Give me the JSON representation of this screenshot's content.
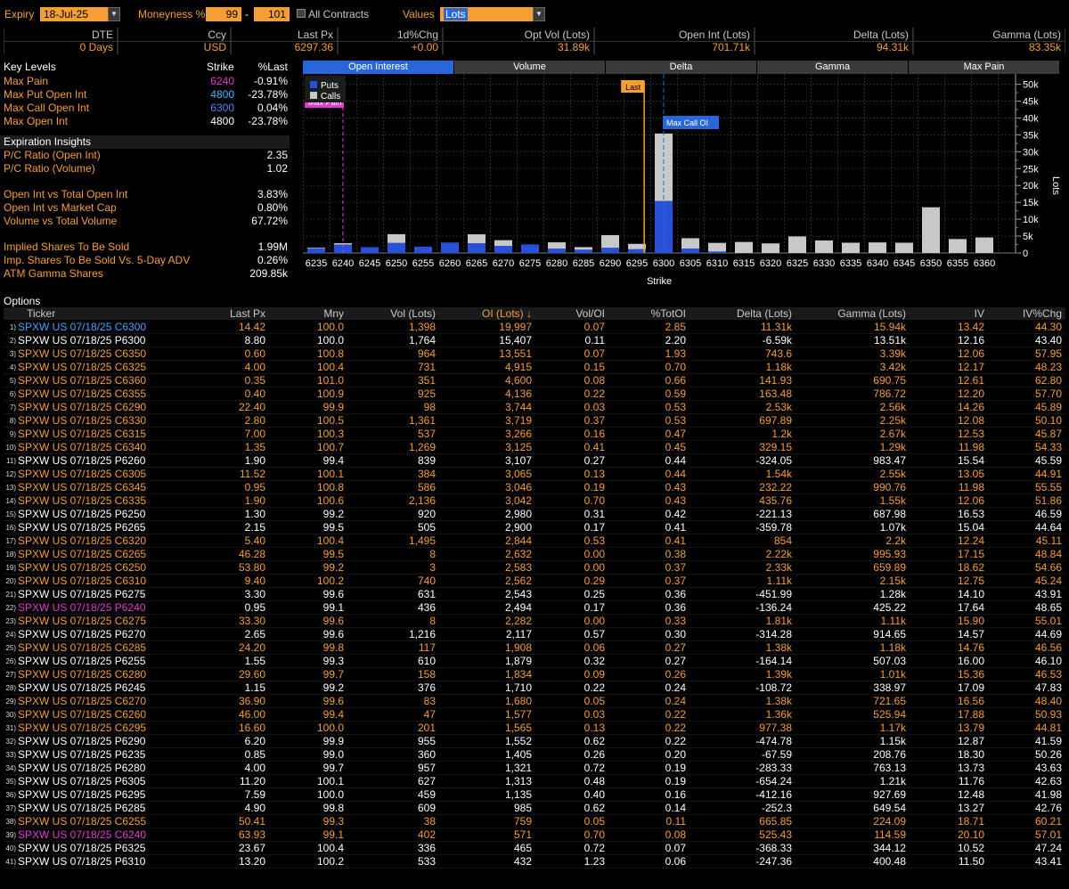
{
  "toolbar": {
    "expiry_label": "Expiry",
    "expiry_value": "18-Jul-25",
    "moneyness_label": "Moneyness %",
    "moneyness_low": "99",
    "moneyness_sep": "-",
    "moneyness_high": "101",
    "all_contracts_label": "All Contracts",
    "values_label": "Values",
    "values_value": "Lots"
  },
  "summary": {
    "headers": [
      "DTE",
      "Ccy",
      "Last Px",
      "1d%Chg",
      "Opt Vol (Lots)",
      "Open Int (Lots)",
      "Delta (Lots)",
      "Gamma (Lots)"
    ],
    "values": [
      "0 Days",
      "USD",
      "6297.36",
      "+0.00",
      "31.89k",
      "701.71k",
      "94.31k",
      "83.35k"
    ]
  },
  "key_levels": {
    "title": "Key Levels",
    "col_strike": "Strike",
    "col_pct": "%Last",
    "rows": [
      {
        "label": "Max Pain",
        "strike": "6240",
        "pct": "-0.91%",
        "color": "#e23bd3"
      },
      {
        "label": "Max Put Open Int",
        "strike": "4800",
        "pct": "-23.78%",
        "color": "#46b4ff"
      },
      {
        "label": "Max Call Open Int",
        "strike": "6300",
        "pct": "0.04%",
        "color": "#5b7fff"
      },
      {
        "label": "Max Open Int",
        "strike": "4800",
        "pct": "-23.78%",
        "color": "#ffffff"
      }
    ]
  },
  "insights": {
    "title": "Expiration Insights",
    "rows": [
      {
        "label": "P/C Ratio (Open Int)",
        "value": "2.35"
      },
      {
        "label": "P/C Ratio (Volume)",
        "value": "1.02"
      },
      {
        "label": "Open Int vs Total Open Int",
        "value": "3.83%"
      },
      {
        "label": "Open Int vs Market Cap",
        "value": "0.80%"
      },
      {
        "label": "Volume vs Total Volume",
        "value": "67.72%"
      },
      {
        "label": "Implied Shares To Be Sold",
        "value": "1.99M"
      },
      {
        "label": "Imp. Shares To Be Sold Vs. 5-Day ADV",
        "value": "0.26%"
      },
      {
        "label": "ATM Gamma Shares",
        "value": "209.85k"
      }
    ]
  },
  "chart_tabs": [
    "Open Interest",
    "Volume",
    "Delta",
    "Gamma",
    "Max Pain"
  ],
  "chart_data": {
    "type": "bar",
    "stacked": true,
    "xlabel": "Strike",
    "ylabel": "Lots",
    "ylim": [
      0,
      52000
    ],
    "yticks": [
      "0",
      "5k",
      "10k",
      "15k",
      "20k",
      "25k",
      "30k",
      "35k",
      "40k",
      "45k",
      "50k"
    ],
    "categories": [
      "6235",
      "6240",
      "6245",
      "6250",
      "6255",
      "6260",
      "6265",
      "6270",
      "6275",
      "6280",
      "6285",
      "6290",
      "6295",
      "6300",
      "6305",
      "6310",
      "6315",
      "6320",
      "6325",
      "6330",
      "6335",
      "6340",
      "6345",
      "6350",
      "6355",
      "6360"
    ],
    "series": [
      {
        "name": "Puts",
        "color": "#2850d8",
        "values": [
          1405,
          2494,
          1710,
          2980,
          1879,
          3107,
          2900,
          2117,
          2543,
          1321,
          985,
          1552,
          1135,
          15407,
          1313,
          432,
          0,
          0,
          0,
          0,
          0,
          0,
          0,
          0,
          0,
          0
        ]
      },
      {
        "name": "Calls",
        "color": "#c8c8c8",
        "values": [
          200,
          400,
          0,
          2583,
          0,
          0,
          2632,
          1680,
          0,
          1834,
          759,
          3744,
          1565,
          19997,
          3065,
          2562,
          3266,
          2844,
          4915,
          3719,
          3042,
          3125,
          3046,
          13551,
          4136,
          4600
        ]
      }
    ],
    "legend_position": "top-left",
    "annotations": [
      {
        "text": "Max Pain",
        "strike": "6240",
        "color": "#e23bd3"
      },
      {
        "text": "Last",
        "strike": "6297.36",
        "color": "#f59e35"
      },
      {
        "text": "Max Call OI",
        "strike": "6300",
        "color": "#2966d8"
      }
    ]
  },
  "options": {
    "title": "Options",
    "headers": [
      "Ticker",
      "Last Px",
      "Mny",
      "Vol (Lots)",
      "OI (Lots) ↓",
      "Vol/OI",
      "%TotOI",
      "Delta (Lots)",
      "Gamma (Lots)",
      "IV",
      "IV%Chg"
    ],
    "rows": [
      {
        "i": "1)",
        "t": "SPXW US 07/18/25 C6300",
        "c": "#46a0ff",
        "v": [
          "14.42",
          "100.0",
          "1,398",
          "19,997",
          "0.07",
          "2.85",
          "11.31k",
          "15.94k",
          "13.42",
          "44.30"
        ]
      },
      {
        "i": "2)",
        "t": "SPXW US 07/18/25 P6300",
        "c": "#ffffff",
        "v": [
          "8.80",
          "100.0",
          "1,764",
          "15,407",
          "0.11",
          "2.20",
          "-6.59k",
          "13.51k",
          "12.16",
          "43.40"
        ]
      },
      {
        "i": "3)",
        "t": "SPXW US 07/18/25 C6350",
        "c": "#f59e35",
        "v": [
          "0.60",
          "100.8",
          "964",
          "13,551",
          "0.07",
          "1.93",
          "743.6",
          "3.39k",
          "12.06",
          "57.95"
        ]
      },
      {
        "i": "4)",
        "t": "SPXW US 07/18/25 C6325",
        "c": "#f59e35",
        "v": [
          "4.00",
          "100.4",
          "731",
          "4,915",
          "0.15",
          "0.70",
          "1.18k",
          "3.42k",
          "12.17",
          "48.23"
        ]
      },
      {
        "i": "5)",
        "t": "SPXW US 07/18/25 C6360",
        "c": "#f59e35",
        "v": [
          "0.35",
          "101.0",
          "351",
          "4,600",
          "0.08",
          "0.66",
          "141.93",
          "690.75",
          "12.61",
          "62.80"
        ]
      },
      {
        "i": "6)",
        "t": "SPXW US 07/18/25 C6355",
        "c": "#f59e35",
        "v": [
          "0.40",
          "100.9",
          "925",
          "4,136",
          "0.22",
          "0.59",
          "163.48",
          "786.72",
          "12.20",
          "57.70"
        ]
      },
      {
        "i": "7)",
        "t": "SPXW US 07/18/25 C6290",
        "c": "#f59e35",
        "v": [
          "22.40",
          "99.9",
          "98",
          "3,744",
          "0.03",
          "0.53",
          "2.53k",
          "2.56k",
          "14.26",
          "45.89"
        ]
      },
      {
        "i": "8)",
        "t": "SPXW US 07/18/25 C6330",
        "c": "#f59e35",
        "v": [
          "2.80",
          "100.5",
          "1,361",
          "3,719",
          "0.37",
          "0.53",
          "697.89",
          "2.25k",
          "12.08",
          "50.10"
        ]
      },
      {
        "i": "9)",
        "t": "SPXW US 07/18/25 C6315",
        "c": "#f59e35",
        "v": [
          "7.00",
          "100.3",
          "537",
          "3,266",
          "0.16",
          "0.47",
          "1.2k",
          "2.67k",
          "12.53",
          "45.87"
        ]
      },
      {
        "i": "10)",
        "t": "SPXW US 07/18/25 C6340",
        "c": "#f59e35",
        "v": [
          "1.35",
          "100.7",
          "1,269",
          "3,125",
          "0.41",
          "0.45",
          "329.15",
          "1.29k",
          "11.98",
          "54.33"
        ]
      },
      {
        "i": "11)",
        "t": "SPXW US 07/18/25 P6260",
        "c": "#ffffff",
        "v": [
          "1.90",
          "99.4",
          "839",
          "3,107",
          "0.27",
          "0.44",
          "-324.05",
          "983.47",
          "15.54",
          "45.59"
        ]
      },
      {
        "i": "12)",
        "t": "SPXW US 07/18/25 C6305",
        "c": "#f59e35",
        "v": [
          "11.52",
          "100.1",
          "384",
          "3,065",
          "0.13",
          "0.44",
          "1.54k",
          "2.55k",
          "13.05",
          "44.91"
        ]
      },
      {
        "i": "13)",
        "t": "SPXW US 07/18/25 C6345",
        "c": "#f59e35",
        "v": [
          "0.95",
          "100.8",
          "586",
          "3,046",
          "0.19",
          "0.43",
          "232.22",
          "990.76",
          "11.98",
          "55.55"
        ]
      },
      {
        "i": "14)",
        "t": "SPXW US 07/18/25 C6335",
        "c": "#f59e35",
        "v": [
          "1.90",
          "100.6",
          "2,136",
          "3,042",
          "0.70",
          "0.43",
          "435.76",
          "1.55k",
          "12.06",
          "51.86"
        ]
      },
      {
        "i": "15)",
        "t": "SPXW US 07/18/25 P6250",
        "c": "#ffffff",
        "v": [
          "1.30",
          "99.2",
          "920",
          "2,980",
          "0.31",
          "0.42",
          "-221.13",
          "687.98",
          "16.53",
          "46.59"
        ]
      },
      {
        "i": "16)",
        "t": "SPXW US 07/18/25 P6265",
        "c": "#ffffff",
        "v": [
          "2.15",
          "99.5",
          "505",
          "2,900",
          "0.17",
          "0.41",
          "-359.78",
          "1.07k",
          "15.04",
          "44.64"
        ]
      },
      {
        "i": "17)",
        "t": "SPXW US 07/18/25 C6320",
        "c": "#f59e35",
        "v": [
          "5.40",
          "100.4",
          "1,495",
          "2,844",
          "0.53",
          "0.41",
          "854",
          "2.2k",
          "12.24",
          "45.11"
        ]
      },
      {
        "i": "18)",
        "t": "SPXW US 07/18/25 C6265",
        "c": "#f59e35",
        "v": [
          "46.28",
          "99.5",
          "8",
          "2,632",
          "0.00",
          "0.38",
          "2.22k",
          "995.93",
          "17.15",
          "48.84"
        ]
      },
      {
        "i": "19)",
        "t": "SPXW US 07/18/25 C6250",
        "c": "#f59e35",
        "v": [
          "53.80",
          "99.2",
          "3",
          "2,583",
          "0.00",
          "0.37",
          "2.33k",
          "659.89",
          "18.62",
          "54.66"
        ]
      },
      {
        "i": "20)",
        "t": "SPXW US 07/18/25 C6310",
        "c": "#f59e35",
        "v": [
          "9.40",
          "100.2",
          "740",
          "2,562",
          "0.29",
          "0.37",
          "1.11k",
          "2.15k",
          "12.75",
          "45.24"
        ]
      },
      {
        "i": "21)",
        "t": "SPXW US 07/18/25 P6275",
        "c": "#ffffff",
        "v": [
          "3.30",
          "99.6",
          "631",
          "2,543",
          "0.25",
          "0.36",
          "-451.99",
          "1.28k",
          "14.10",
          "43.91"
        ]
      },
      {
        "i": "22)",
        "t": "SPXW US 07/18/25 P6240",
        "c": "#e23bd3",
        "v": [
          "0.95",
          "99.1",
          "436",
          "2,494",
          "0.17",
          "0.36",
          "-136.24",
          "425.22",
          "17.64",
          "48.65"
        ]
      },
      {
        "i": "23)",
        "t": "SPXW US 07/18/25 C6275",
        "c": "#f59e35",
        "v": [
          "33.30",
          "99.6",
          "8",
          "2,282",
          "0.00",
          "0.33",
          "1.81k",
          "1.11k",
          "15.90",
          "55.01"
        ]
      },
      {
        "i": "24)",
        "t": "SPXW US 07/18/25 P6270",
        "c": "#ffffff",
        "v": [
          "2.65",
          "99.6",
          "1,216",
          "2,117",
          "0.57",
          "0.30",
          "-314.28",
          "914.65",
          "14.57",
          "44.69"
        ]
      },
      {
        "i": "25)",
        "t": "SPXW US 07/18/25 C6285",
        "c": "#f59e35",
        "v": [
          "24.20",
          "99.8",
          "117",
          "1,908",
          "0.06",
          "0.27",
          "1.38k",
          "1.18k",
          "14.76",
          "46.56"
        ]
      },
      {
        "i": "26)",
        "t": "SPXW US 07/18/25 P6255",
        "c": "#ffffff",
        "v": [
          "1.55",
          "99.3",
          "610",
          "1,879",
          "0.32",
          "0.27",
          "-164.14",
          "507.03",
          "16.00",
          "46.10"
        ]
      },
      {
        "i": "27)",
        "t": "SPXW US 07/18/25 C6280",
        "c": "#f59e35",
        "v": [
          "29.60",
          "99.7",
          "158",
          "1,834",
          "0.09",
          "0.26",
          "1.39k",
          "1.01k",
          "15.36",
          "46.53"
        ]
      },
      {
        "i": "28)",
        "t": "SPXW US 07/18/25 P6245",
        "c": "#ffffff",
        "v": [
          "1.15",
          "99.2",
          "376",
          "1,710",
          "0.22",
          "0.24",
          "-108.72",
          "338.97",
          "17.09",
          "47.83"
        ]
      },
      {
        "i": "29)",
        "t": "SPXW US 07/18/25 C6270",
        "c": "#f59e35",
        "v": [
          "36.90",
          "99.6",
          "83",
          "1,680",
          "0.05",
          "0.24",
          "1.38k",
          "721.65",
          "16.56",
          "48.40"
        ]
      },
      {
        "i": "30)",
        "t": "SPXW US 07/18/25 C6260",
        "c": "#f59e35",
        "v": [
          "46.00",
          "99.4",
          "47",
          "1,577",
          "0.03",
          "0.22",
          "1.36k",
          "525.94",
          "17.88",
          "50.93"
        ]
      },
      {
        "i": "31)",
        "t": "SPXW US 07/18/25 C6295",
        "c": "#f59e35",
        "v": [
          "16.60",
          "100.0",
          "201",
          "1,565",
          "0.13",
          "0.22",
          "977.38",
          "1.17k",
          "13.79",
          "44.81"
        ]
      },
      {
        "i": "32)",
        "t": "SPXW US 07/18/25 P6290",
        "c": "#ffffff",
        "v": [
          "6.20",
          "99.9",
          "955",
          "1,552",
          "0.62",
          "0.22",
          "-474.78",
          "1.15k",
          "12.87",
          "41.59"
        ]
      },
      {
        "i": "33)",
        "t": "SPXW US 07/18/25 P6235",
        "c": "#ffffff",
        "v": [
          "0.85",
          "99.0",
          "360",
          "1,405",
          "0.26",
          "0.20",
          "-67.59",
          "208.76",
          "18.30",
          "50.26"
        ]
      },
      {
        "i": "34)",
        "t": "SPXW US 07/18/25 P6280",
        "c": "#ffffff",
        "v": [
          "4.00",
          "99.7",
          "957",
          "1,321",
          "0.72",
          "0.19",
          "-283.33",
          "763.13",
          "13.73",
          "43.63"
        ]
      },
      {
        "i": "35)",
        "t": "SPXW US 07/18/25 P6305",
        "c": "#ffffff",
        "v": [
          "11.20",
          "100.1",
          "627",
          "1,313",
          "0.48",
          "0.19",
          "-654.24",
          "1.21k",
          "11.76",
          "42.63"
        ]
      },
      {
        "i": "36)",
        "t": "SPXW US 07/18/25 P6295",
        "c": "#ffffff",
        "v": [
          "7.59",
          "100.0",
          "459",
          "1,135",
          "0.40",
          "0.16",
          "-412.16",
          "927.69",
          "12.48",
          "41.98"
        ]
      },
      {
        "i": "37)",
        "t": "SPXW US 07/18/25 P6285",
        "c": "#ffffff",
        "v": [
          "4.90",
          "99.8",
          "609",
          "985",
          "0.62",
          "0.14",
          "-252.3",
          "649.54",
          "13.27",
          "42.76"
        ]
      },
      {
        "i": "38)",
        "t": "SPXW US 07/18/25 C6255",
        "c": "#f59e35",
        "v": [
          "50.41",
          "99.3",
          "38",
          "759",
          "0.05",
          "0.11",
          "665.85",
          "224.09",
          "18.71",
          "60.21"
        ]
      },
      {
        "i": "39)",
        "t": "SPXW US 07/18/25 C6240",
        "c": "#e23bd3",
        "v": [
          "63.93",
          "99.1",
          "402",
          "571",
          "0.70",
          "0.08",
          "525.43",
          "114.59",
          "20.10",
          "57.01"
        ]
      },
      {
        "i": "40)",
        "t": "SPXW US 07/18/25 P6325",
        "c": "#ffffff",
        "v": [
          "23.67",
          "100.4",
          "336",
          "465",
          "0.72",
          "0.07",
          "-368.33",
          "344.12",
          "10.52",
          "47.24"
        ]
      },
      {
        "i": "41)",
        "t": "SPXW US 07/18/25 P6310",
        "c": "#ffffff",
        "v": [
          "13.20",
          "100.2",
          "533",
          "432",
          "1.23",
          "0.06",
          "-247.36",
          "400.48",
          "11.50",
          "43.41"
        ]
      }
    ]
  }
}
